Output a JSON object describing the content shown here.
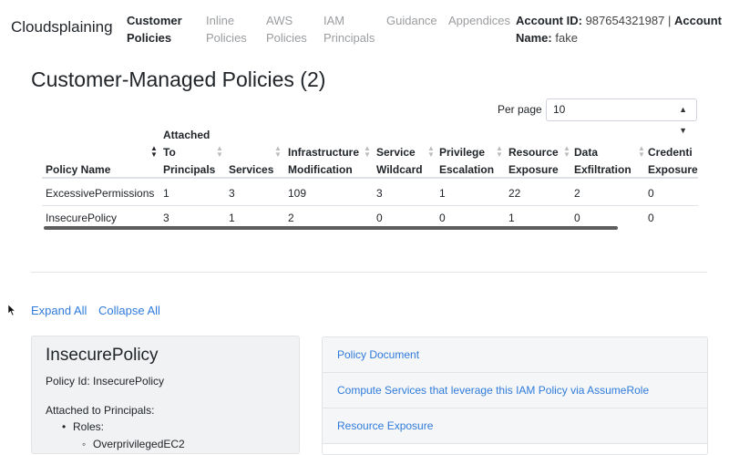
{
  "navbar": {
    "brand": "Cloudsplaining",
    "items": [
      {
        "line1": "Customer",
        "line2": "Policies"
      },
      {
        "line1": "Inline",
        "line2": "Policies"
      },
      {
        "line1": "AWS",
        "line2": "Policies"
      },
      {
        "line1": "IAM",
        "line2": "Principals"
      },
      {
        "line1": "Guidance",
        "line2": ""
      },
      {
        "line1": "Appendices",
        "line2": ""
      }
    ],
    "account_id_label": "Account ID:",
    "account_id": "987654321987",
    "separator": "|",
    "account_label": "Account",
    "name_label": "Name:",
    "account_name": "fake"
  },
  "page_title": "Customer-Managed Policies (2)",
  "table_controls": {
    "per_page_label": "Per page",
    "per_page_value": "10"
  },
  "table": {
    "headers": [
      {
        "line1": "",
        "line2": "",
        "line3": "Policy Name"
      },
      {
        "line1": "Attached",
        "line2": "To",
        "line3": "Principals"
      },
      {
        "line1": "",
        "line2": "",
        "line3": "Services"
      },
      {
        "line1": "",
        "line2": "Infrastructure",
        "line3": "Modification"
      },
      {
        "line1": "",
        "line2": "Service",
        "line3": "Wildcard"
      },
      {
        "line1": "",
        "line2": "Privilege",
        "line3": "Escalation"
      },
      {
        "line1": "",
        "line2": "Resource",
        "line3": "Exposure"
      },
      {
        "line1": "",
        "line2": "Data",
        "line3": "Exfiltration"
      },
      {
        "line1": "",
        "line2": "Credenti",
        "line3": "Exposure"
      }
    ],
    "rows": [
      [
        "ExcessivePermissions",
        "1",
        "3",
        "109",
        "3",
        "1",
        "22",
        "2",
        "0"
      ],
      [
        "InsecurePolicy",
        "3",
        "1",
        "2",
        "0",
        "0",
        "1",
        "0",
        "0"
      ]
    ]
  },
  "links": {
    "expand_all": "Expand All",
    "collapse_all": "Collapse All"
  },
  "policy_card": {
    "title": "InsecurePolicy",
    "policy_id_label": "Policy Id: InsecurePolicy",
    "attached_label": "Attached to Principals:",
    "roles_label": "Roles:",
    "role_item": "OverprivilegedEC2"
  },
  "accordion": {
    "items": [
      "Policy Document",
      "Compute Services that leverage this IAM Policy via AssumeRole",
      "Resource Exposure"
    ]
  },
  "colors": {
    "link": "#2f7bdc",
    "text": "#212529",
    "muted_nav": "#9a9da0",
    "card_bg": "#f1f2f3"
  }
}
